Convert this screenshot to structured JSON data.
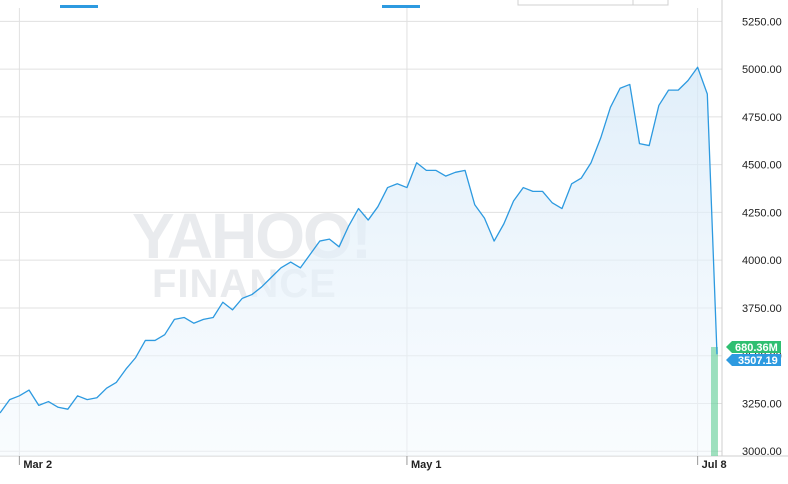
{
  "chart_data": {
    "type": "area",
    "watermark": {
      "line1": "YAHOO!",
      "line2": "FINANCE"
    },
    "ylim": [
      2975,
      5320
    ],
    "y_ticks": [
      "5250.00",
      "5000.00",
      "4750.00",
      "4500.00",
      "4250.00",
      "4000.00",
      "3750.00",
      "3500.00",
      "3250.00",
      "3000.00"
    ],
    "y_tick_values": [
      5250,
      5000,
      4750,
      4500,
      4250,
      4000,
      3750,
      3500,
      3250,
      3000
    ],
    "x_ticks": [
      {
        "label": "Mar 2",
        "index": 2
      },
      {
        "label": "May 1",
        "index": 42
      },
      {
        "label": "Jul 8",
        "index": 72
      }
    ],
    "series": [
      {
        "values": [
          3200,
          3270,
          3290,
          3320,
          3240,
          3260,
          3230,
          3220,
          3290,
          3270,
          3280,
          3330,
          3360,
          3430,
          3490,
          3580,
          3580,
          3610,
          3690,
          3700,
          3670,
          3690,
          3700,
          3780,
          3740,
          3800,
          3820,
          3860,
          3910,
          3960,
          3990,
          3960,
          4030,
          4100,
          4110,
          4070,
          4180,
          4270,
          4210,
          4280,
          4380,
          4400,
          4380,
          4510,
          4470,
          4470,
          4440,
          4460,
          4470,
          4290,
          4220,
          4100,
          4190,
          4310,
          4380,
          4360,
          4360,
          4300,
          4270,
          4400,
          4430,
          4510,
          4640,
          4800,
          4900,
          4920,
          4610,
          4600,
          4810,
          4890,
          4890,
          4940,
          5010,
          4870,
          3507.19
        ]
      }
    ],
    "volume_last": 680.36,
    "last_value": 3507.19,
    "last_labels": {
      "volume": "680.36M",
      "price": "3507.19"
    },
    "colors": {
      "line": "#2d9ae0",
      "fill_top": "#d6e9f8",
      "fill_bottom": "#f3f9fe",
      "volume": "#2fbf71",
      "grid": "#e0e0e0"
    }
  }
}
